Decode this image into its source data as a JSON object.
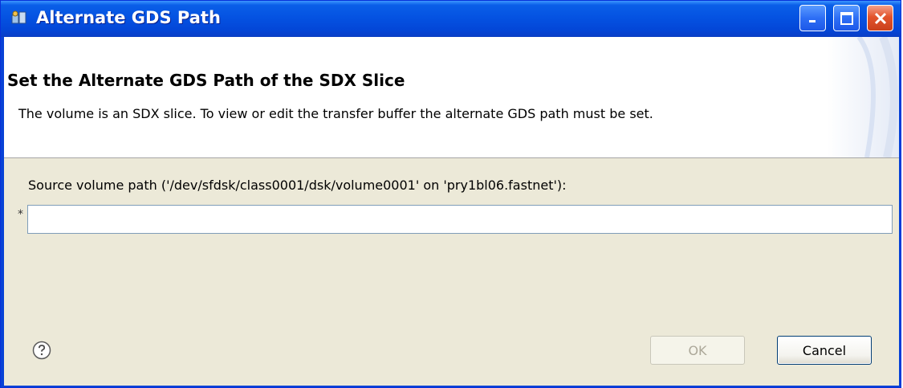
{
  "window": {
    "title": "Alternate GDS Path",
    "minimize_icon": "minimize-icon",
    "maximize_icon": "maximize-icon",
    "close_icon": "close-icon"
  },
  "header": {
    "title": "Set the Alternate GDS Path of the SDX Slice",
    "description": "The volume is an SDX slice. To view or edit the transfer buffer the alternate GDS path must be set."
  },
  "form": {
    "source_label": "Source volume path ('/dev/sfdsk/class0001/dsk/volume0001' on 'pry1bl06.fastnet'):",
    "required_marker": "*",
    "source_value": ""
  },
  "buttons": {
    "ok": "OK",
    "cancel": "Cancel",
    "ok_enabled": false
  },
  "colors": {
    "titlebar": "#0553e2",
    "dialog_body": "#ece9d8",
    "header_bg": "#ffffff",
    "close_button": "#e3542c"
  }
}
